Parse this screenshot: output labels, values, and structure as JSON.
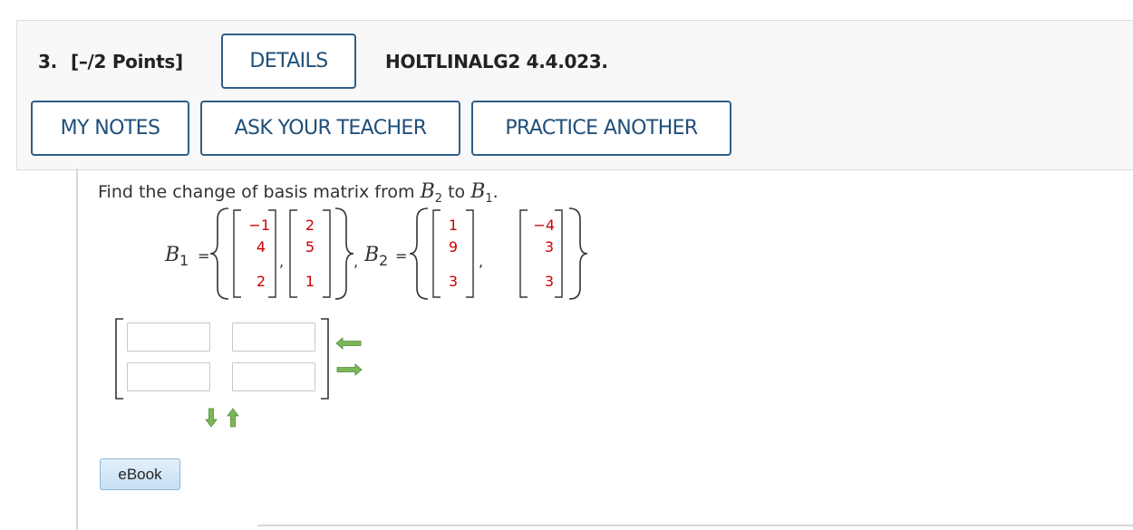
{
  "question": {
    "number": "3.",
    "points": "[–/2 Points]",
    "details_label": "DETAILS",
    "code": "HOLTLINALG2 4.4.023."
  },
  "actions": {
    "my_notes": "MY NOTES",
    "ask_teacher": "ASK YOUR TEACHER",
    "practice_another": "PRACTICE ANOTHER"
  },
  "prompt": {
    "text": "Find the change of basis matrix from",
    "from_symbol": "B",
    "from_sub": "2",
    "connector": "to",
    "to_symbol": "B",
    "to_sub": "1",
    "end": "."
  },
  "sets": {
    "b1_symbol": "B",
    "b1_sub": "1",
    "b2_symbol": "B",
    "b2_sub": "2",
    "equals": "=",
    "b1_vectors": [
      [
        "−1",
        "4",
        "2"
      ],
      [
        "2",
        "5",
        "1"
      ]
    ],
    "b2_vectors": [
      [
        "1",
        "9",
        "3"
      ],
      [
        "−4",
        "3",
        "3"
      ]
    ]
  },
  "answer": {
    "cells": [
      [
        "",
        ""
      ],
      [
        "",
        ""
      ]
    ]
  },
  "ebook_label": "eBook",
  "colors": {
    "button_border": "#2f5f8a",
    "button_text": "#1f4f7a",
    "entry_red": "#cc0000",
    "arrow_green": "#5a9a3a"
  },
  "icons": {
    "row_arrows": [
      "arrow-left-icon",
      "arrow-right-icon"
    ],
    "column_arrows": [
      "arrow-down-icon",
      "arrow-up-icon"
    ]
  }
}
